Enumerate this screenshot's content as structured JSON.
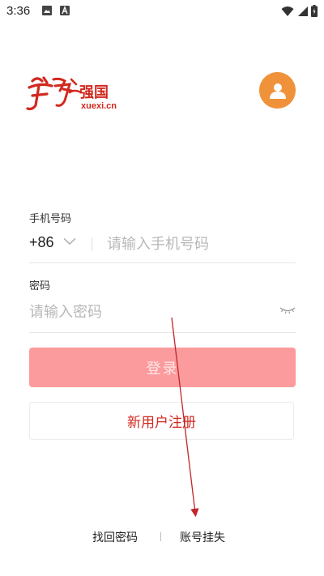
{
  "status_bar": {
    "time": "3:36",
    "left_icons": [
      "image-icon",
      "app-a-icon"
    ],
    "right_icons": [
      "wifi-icon",
      "signal-icon",
      "battery-icon"
    ]
  },
  "logo": {
    "brand_text": "学习强国",
    "domain_text": "xuexi.cn",
    "color": "#d1291f"
  },
  "avatar": {
    "icon": "user-icon",
    "color": "#f0923a"
  },
  "form": {
    "phone_label": "手机号码",
    "country_code": "+86",
    "phone_placeholder": "请输入手机号码",
    "phone_value": "",
    "password_label": "密码",
    "password_placeholder": "请输入密码",
    "password_value": ""
  },
  "buttons": {
    "login": "登录",
    "register": "新用户注册"
  },
  "links": {
    "find_password": "找回密码",
    "account_loss": "账号挂失"
  },
  "colors": {
    "login_bg": "#fc9b9d",
    "register_text": "#d1291f",
    "annotation_arrow": "#c0262b"
  }
}
